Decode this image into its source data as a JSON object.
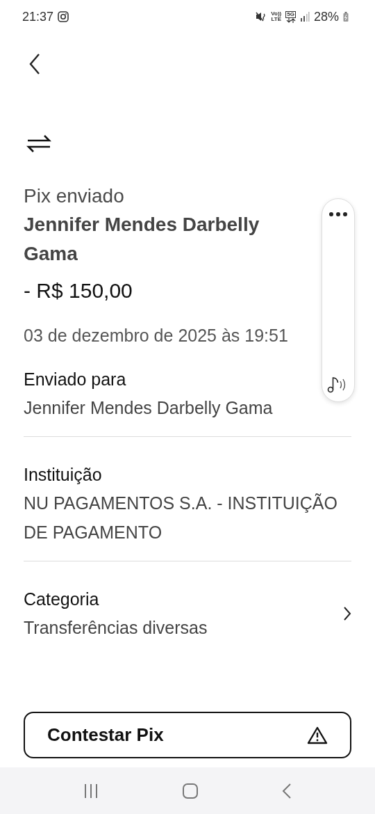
{
  "status_bar": {
    "time": "21:37",
    "volte_top": "Vo))",
    "volte_bottom": "LTE",
    "network": "5G",
    "battery": "28%"
  },
  "header": {
    "kind": "transfer"
  },
  "summary": {
    "label": "Pix enviado",
    "name": "Jennifer Mendes Darbelly Gama",
    "amount": "- R$ 150,00",
    "date": "03 de dezembro de 2025 às 19:51"
  },
  "floating_panel": {
    "kind": "pill"
  },
  "details": [
    {
      "kind": "info",
      "label": "Enviado para",
      "value": "Jennifer Mendes Darbelly Gama"
    },
    {
      "kind": "info",
      "label": "Instituição",
      "value": "NU PAGAMENTOS S.A. - INSTITUIÇÃO DE PAGAMENTO"
    },
    {
      "kind": "link",
      "label": "Categoria",
      "value": "Transferências diversas"
    }
  ],
  "action_button": {
    "label": "Contestar Pix"
  }
}
